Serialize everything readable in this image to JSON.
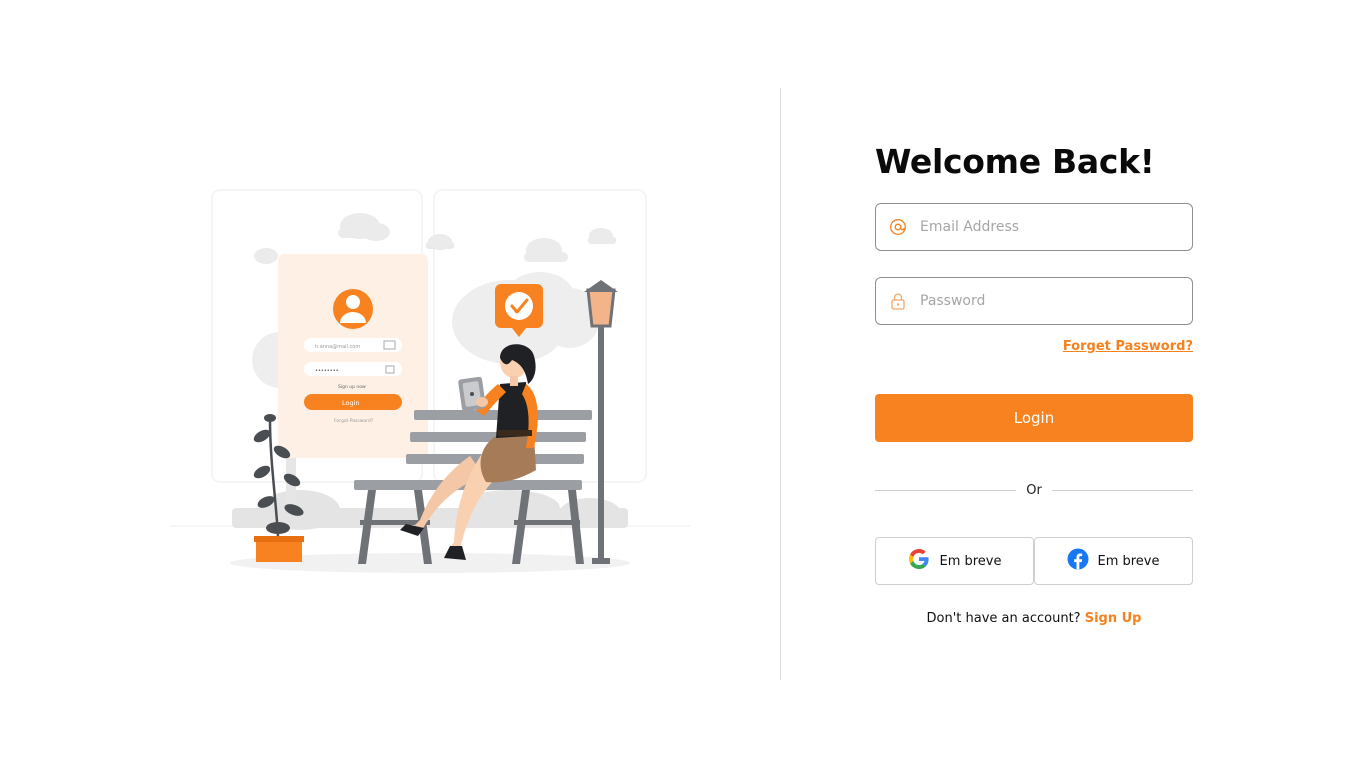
{
  "illustration": {
    "name": "login-illustration",
    "mock_email": "h.anna@mail.com",
    "mock_password": "••••••••",
    "mock_signup": "Sign up now",
    "mock_login": "Login",
    "mock_forgot": "Forgot Password?"
  },
  "form": {
    "title": "Welcome Back!",
    "email": {
      "placeholder": "Email Address",
      "value": "",
      "icon": "at-icon"
    },
    "password": {
      "placeholder": "Password",
      "value": "",
      "icon": "lock-icon"
    },
    "forgot_label": "Forget Password?",
    "login_label": "Login",
    "or_label": "Or",
    "social": [
      {
        "provider": "google",
        "label": "Em breve",
        "icon": "google-icon"
      },
      {
        "provider": "facebook",
        "label": "Em breve",
        "icon": "facebook-icon"
      }
    ],
    "signup_prompt": "Don't have an account?",
    "signup_link": "Sign Up"
  },
  "colors": {
    "accent": "#f7821f",
    "text": "#0a0a0a",
    "border": "#8f8f8f",
    "divider": "#d9d9d9"
  }
}
